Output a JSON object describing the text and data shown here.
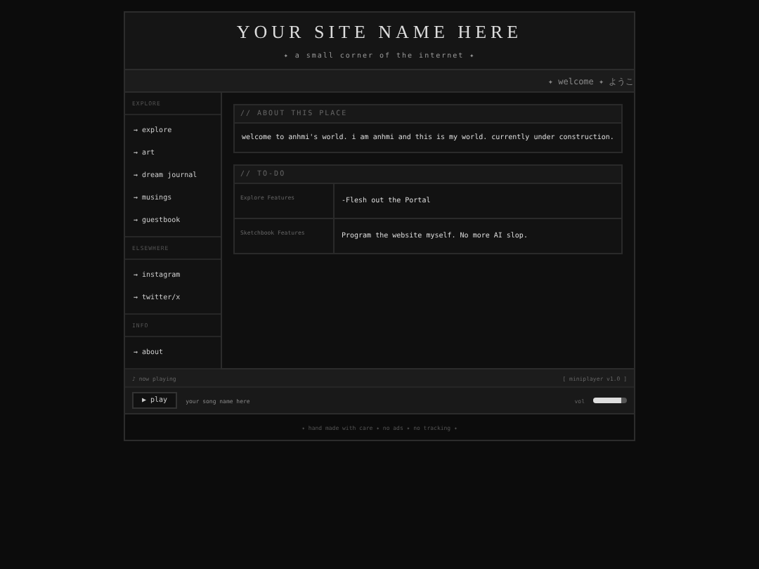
{
  "header": {
    "title": "YOUR SITE NAME HERE",
    "tagline": "✦ a small corner of the internet ✦"
  },
  "marquee": "✦ welcome ✦ ようこ",
  "sidebar": [
    {
      "heading": "EXPLORE",
      "links": [
        "→ explore",
        "→ art",
        "→ dream journal",
        "→ musings",
        "→ guestbook"
      ]
    },
    {
      "heading": "ELSEWHERE",
      "links": [
        "→ instagram",
        "→ twitter/x"
      ]
    },
    {
      "heading": "INFO",
      "links": [
        "→ about"
      ]
    }
  ],
  "about": {
    "heading": "// ABOUT THIS PLACE",
    "text": "welcome to anhmi's world. i am anhmi and this is my world. currently under construction."
  },
  "todo": {
    "heading": "// TO-DO",
    "rows": [
      {
        "label": "Explore Features",
        "value": "-Flesh out the Portal"
      },
      {
        "label": "Sketchbook Features",
        "value": "Program the website myself. No more AI slop."
      }
    ]
  },
  "player": {
    "status": "♪ now playing",
    "version": "[ miniplayer v1.0 ]",
    "button": "▶ play",
    "song": "your song name here",
    "volume_label": "vol",
    "level": 0.85
  },
  "footer": "✦ hand made with care ✦ no ads ✦ no tracking ✦"
}
